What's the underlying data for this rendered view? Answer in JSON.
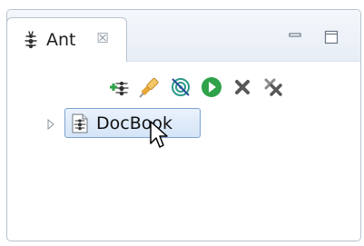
{
  "view": {
    "tab": {
      "title": "Ant",
      "icon": "ant-icon",
      "close_icon": "close-icon",
      "close_glyph": "☒"
    },
    "window_controls": [
      "minimize-icon",
      "maximize-icon"
    ],
    "toolbar": {
      "buttons": [
        "add-buildfile-icon",
        "search-buildfile-icon",
        "hide-internal-targets-icon",
        "run-icon",
        "remove-icon",
        "remove-all-icon"
      ]
    },
    "tree": {
      "items": [
        {
          "label": "DocBook",
          "icon": "buildfile-icon",
          "expanded": false,
          "selected": true
        }
      ]
    },
    "colors": {
      "selection_border": "#7da2ce",
      "selection_fill": "#d4e4f7",
      "run_green": "#2fa24a",
      "header_bg": "#e8eef6"
    }
  }
}
